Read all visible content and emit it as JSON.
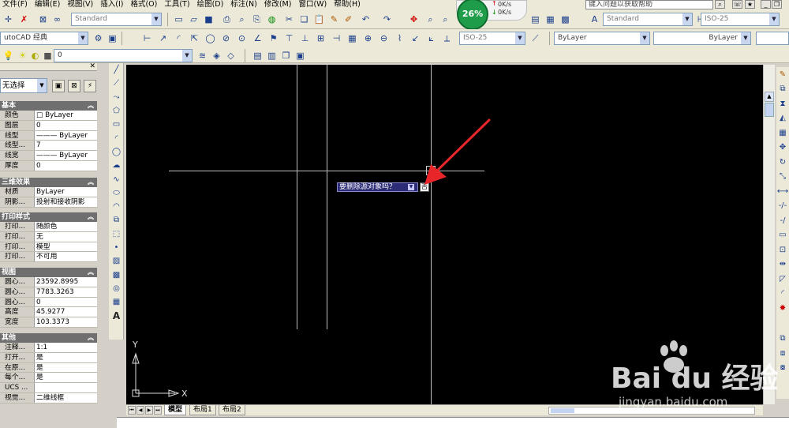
{
  "menu": [
    "文件(F)",
    "编辑(E)",
    "视图(V)",
    "插入(I)",
    "格式(O)",
    "工具(T)",
    "绘图(D)",
    "标注(N)",
    "修改(M)",
    "窗口(W)",
    "帮助(H)"
  ],
  "help_search": "键入问题以获取帮助",
  "toolbar1": {
    "text_style": "Standard",
    "dim_style_right": "Standard",
    "dim_iso": "ISO-25"
  },
  "workspace": "utoCAD 经典",
  "toolbar2": {
    "dim_iso": "ISO-25",
    "color": "ByLayer",
    "linetype": "ByLayer"
  },
  "layer": "0",
  "net_widget": {
    "percent": "26%",
    "up": "0K/s",
    "down": "0K/s"
  },
  "properties": {
    "selection": "无选择",
    "sections": [
      {
        "title": "基本",
        "rows": [
          {
            "k": "颜色",
            "v": "□ ByLayer"
          },
          {
            "k": "图层",
            "v": "0"
          },
          {
            "k": "线型",
            "v": "——— ByLayer"
          },
          {
            "k": "线型...",
            "v": "7"
          },
          {
            "k": "线宽",
            "v": "——— ByLayer"
          },
          {
            "k": "厚度",
            "v": "0"
          }
        ]
      },
      {
        "title": "三维效果",
        "rows": [
          {
            "k": "材质",
            "v": "ByLayer"
          },
          {
            "k": "阴影...",
            "v": "投射和接收阴影"
          }
        ]
      },
      {
        "title": "打印样式",
        "rows": [
          {
            "k": "打印...",
            "v": "随颜色"
          },
          {
            "k": "打印...",
            "v": "无"
          },
          {
            "k": "打印...",
            "v": "模型"
          },
          {
            "k": "打印...",
            "v": "不可用"
          }
        ]
      },
      {
        "title": "视图",
        "rows": [
          {
            "k": "圆心...",
            "v": "23592.8995"
          },
          {
            "k": "圆心...",
            "v": "7783.3263"
          },
          {
            "k": "圆心...",
            "v": "0"
          },
          {
            "k": "高度",
            "v": "45.9277"
          },
          {
            "k": "宽度",
            "v": "103.3373"
          }
        ]
      },
      {
        "title": "其他",
        "rows": [
          {
            "k": "注释...",
            "v": "1:1"
          },
          {
            "k": "打开...",
            "v": "是"
          },
          {
            "k": "在原...",
            "v": "是"
          },
          {
            "k": "每个...",
            "v": "是"
          },
          {
            "k": "UCS ...",
            "v": ""
          },
          {
            "k": "视觉...",
            "v": "二维线框"
          }
        ]
      }
    ]
  },
  "canvas": {
    "prompt_text": "要删除源对象吗？",
    "prompt_input": "否",
    "ucs_x": "X",
    "ucs_y": "Y"
  },
  "tabs": [
    "模型",
    "布局1",
    "布局2"
  ],
  "watermark": {
    "brand": "Bai du 经验",
    "url": "jingyan.baidu.com"
  },
  "colors": {
    "canvas_bg": "#000000",
    "arrow": "#e8262a",
    "prompt_bg": "#2b2b78"
  }
}
